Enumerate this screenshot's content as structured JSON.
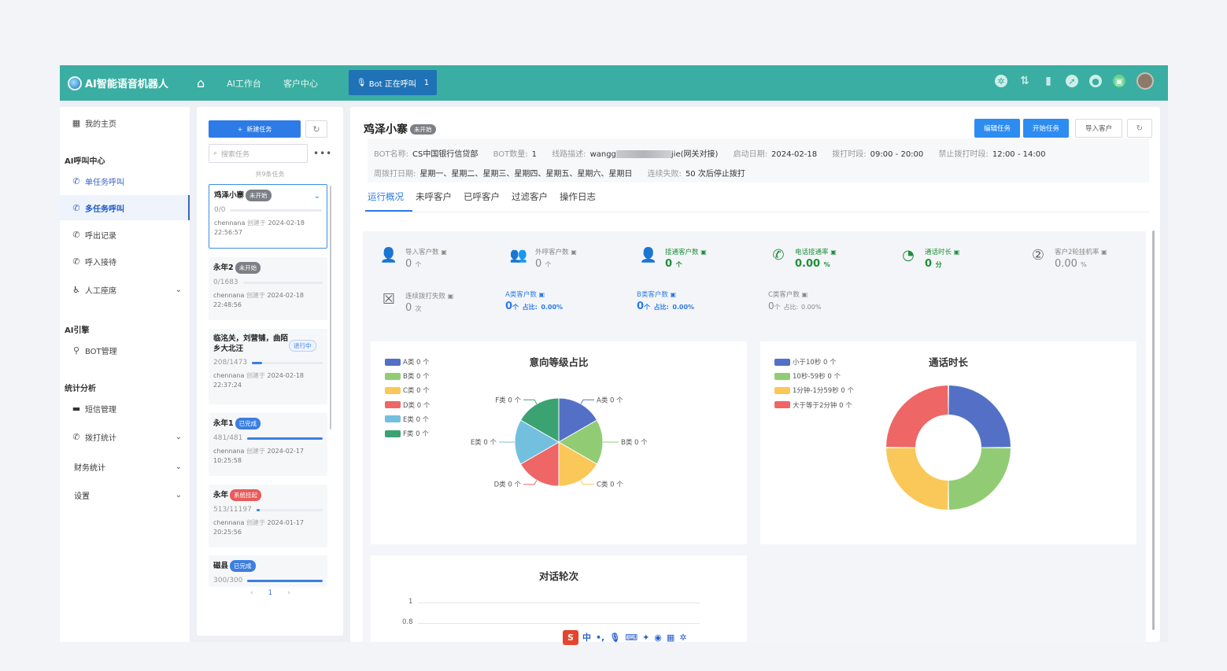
{
  "topbar": {
    "app_title": "AI智能语音机器人",
    "nav": [
      "AI工作台",
      "客户中心"
    ],
    "bot_status_label": "Bot 正在呼叫",
    "bot_status_count": "1"
  },
  "sidebar": {
    "home": "我的主页",
    "group_ai_call": "AI呼叫中心",
    "single_task_call": "单任务呼叫",
    "multi_task_call": "多任务呼叫",
    "call_out_records": "呼出记录",
    "call_in_reception": "呼入接待",
    "manual_seat": "人工座席",
    "group_ai_engine": "AI引擎",
    "bot_manage": "BOT管理",
    "group_stats": "统计分析",
    "sms_manage": "短信管理",
    "dial_stats": "拨打统计",
    "finance_stats": "财务统计",
    "settings": "设置"
  },
  "task_panel": {
    "new_task_label": "新建任务",
    "search_placeholder": "搜索任务",
    "task_count": "共9条任务",
    "created_label": "创建于",
    "tasks": [
      {
        "name": "鸡泽小寨",
        "status": "未开始",
        "progress": "0/0",
        "ratio": 0,
        "creator": "chennana",
        "created": "2024-02-18",
        "time": "22:56:57"
      },
      {
        "name": "永年2",
        "status": "未开始",
        "progress": "0/1683",
        "ratio": 0,
        "creator": "chennana",
        "created": "2024-02-18",
        "time": "22:48:56"
      },
      {
        "name": "临洺关，刘营铺，曲陌乡大北汪",
        "status": "进行中",
        "progress": "208/1473",
        "ratio": 0.14,
        "creator": "chennana",
        "created": "2024-02-18",
        "time": "22:37:24"
      },
      {
        "name": "永年1",
        "status": "已完成",
        "progress": "481/481",
        "ratio": 1,
        "creator": "chennana",
        "created": "2024-02-17",
        "time": "10:25:58"
      },
      {
        "name": "永年",
        "status": "系统挂起",
        "progress": "513/11197",
        "ratio": 0.046,
        "creator": "chennana",
        "created": "2024-01-17",
        "time": "20:25:56"
      },
      {
        "name": "磁县",
        "status": "已完成",
        "progress": "300/300",
        "ratio": 1
      }
    ],
    "current_page": "1"
  },
  "main": {
    "title": "鸡泽小寨",
    "status": "未开始",
    "actions": [
      "编辑任务",
      "开始任务",
      "导入客户"
    ],
    "info": {
      "bot_name_k": "BOT名称:",
      "bot_name_v": "CS中国银行信贷部",
      "bot_count_k": "BOT数量:",
      "bot_count_v": "1",
      "line_k": "线路描述:",
      "line_v_prefix": "wangg",
      "line_v_suffix": "jie(网关对接)",
      "start_k": "启动日期:",
      "start_v": "2024-02-18",
      "dial_time_k": "拨打时段:",
      "dial_time_v": "09:00 - 20:00",
      "ban_time_k": "禁止拨打时段:",
      "ban_time_v": "12:00 - 14:00",
      "cycle_k": "周拨打日期:",
      "cycle_v": "星期一、星期二、星期三、星期四、星期五、星期六、星期日",
      "fail_k": "连续失败:",
      "fail_v": "50 次后停止拨打"
    },
    "tabs": [
      "运行概况",
      "未呼客户",
      "已呼客户",
      "过滤客户",
      "操作日志"
    ],
    "stats": [
      {
        "label": "导入客户数",
        "value": "0",
        "unit": "个"
      },
      {
        "label": "外呼客户数",
        "value": "0",
        "unit": "个"
      },
      {
        "label": "接通客户数",
        "value": "0",
        "unit": "个"
      },
      {
        "label": "电话接通率",
        "value": "0.00",
        "unit": "%"
      },
      {
        "label": "通话时长",
        "value": "0",
        "unit": "分"
      },
      {
        "label": "客户2轮挂机率",
        "value": "0.00",
        "unit": "%"
      },
      {
        "label": "连续拨打失败",
        "value": "0",
        "unit": "次"
      },
      {
        "label": "A类客户数",
        "value": "0",
        "unit": "个",
        "ratio_label": "占比:",
        "ratio": "0.00%"
      },
      {
        "label": "B类客户数",
        "value": "0",
        "unit": "个",
        "ratio_label": "占比:",
        "ratio": "0.00%"
      },
      {
        "label": "C类客户数",
        "value": "0",
        "unit": "个",
        "ratio_label": "占比:",
        "ratio": "0.00%"
      }
    ]
  },
  "chart_data": [
    {
      "type": "pie",
      "title": "意向等级占比",
      "categories": [
        "A类",
        "B类",
        "C类",
        "D类",
        "E类",
        "F类"
      ],
      "values": [
        0,
        0,
        0,
        0,
        0,
        0
      ],
      "legend": [
        "A类 0 个",
        "B类 0 个",
        "C类 0 个",
        "D类 0 个",
        "E类 0 个",
        "F类 0 个"
      ],
      "slice_labels": [
        "A类 0 个",
        "B类 0 个",
        "C类 0 个",
        "D类 0 个",
        "E类 0 个",
        "F类 0 个"
      ],
      "colors": [
        "#5470c6",
        "#91cc75",
        "#fac858",
        "#ee6666",
        "#73c0de",
        "#3ba272"
      ],
      "legend_position": "top-left"
    },
    {
      "type": "pie",
      "title": "通话时长",
      "categories": [
        "小于10秒",
        "10秒-59秒",
        "1分钟-1分59秒",
        "大于等于2分钟"
      ],
      "values": [
        0,
        0,
        0,
        0
      ],
      "legend": [
        "小于10秒 0 个",
        "10秒-59秒 0 个",
        "1分钟-1分59秒 0 个",
        "大于等于2分钟 0 个"
      ],
      "colors": [
        "#5470c6",
        "#91cc75",
        "#fac858",
        "#ee6666"
      ],
      "legend_position": "top-left"
    },
    {
      "type": "bar",
      "title": "对话轮次",
      "y_ticks": [
        "1",
        "0.8"
      ],
      "values": []
    }
  ],
  "ime_bar": {
    "lang": "中"
  }
}
